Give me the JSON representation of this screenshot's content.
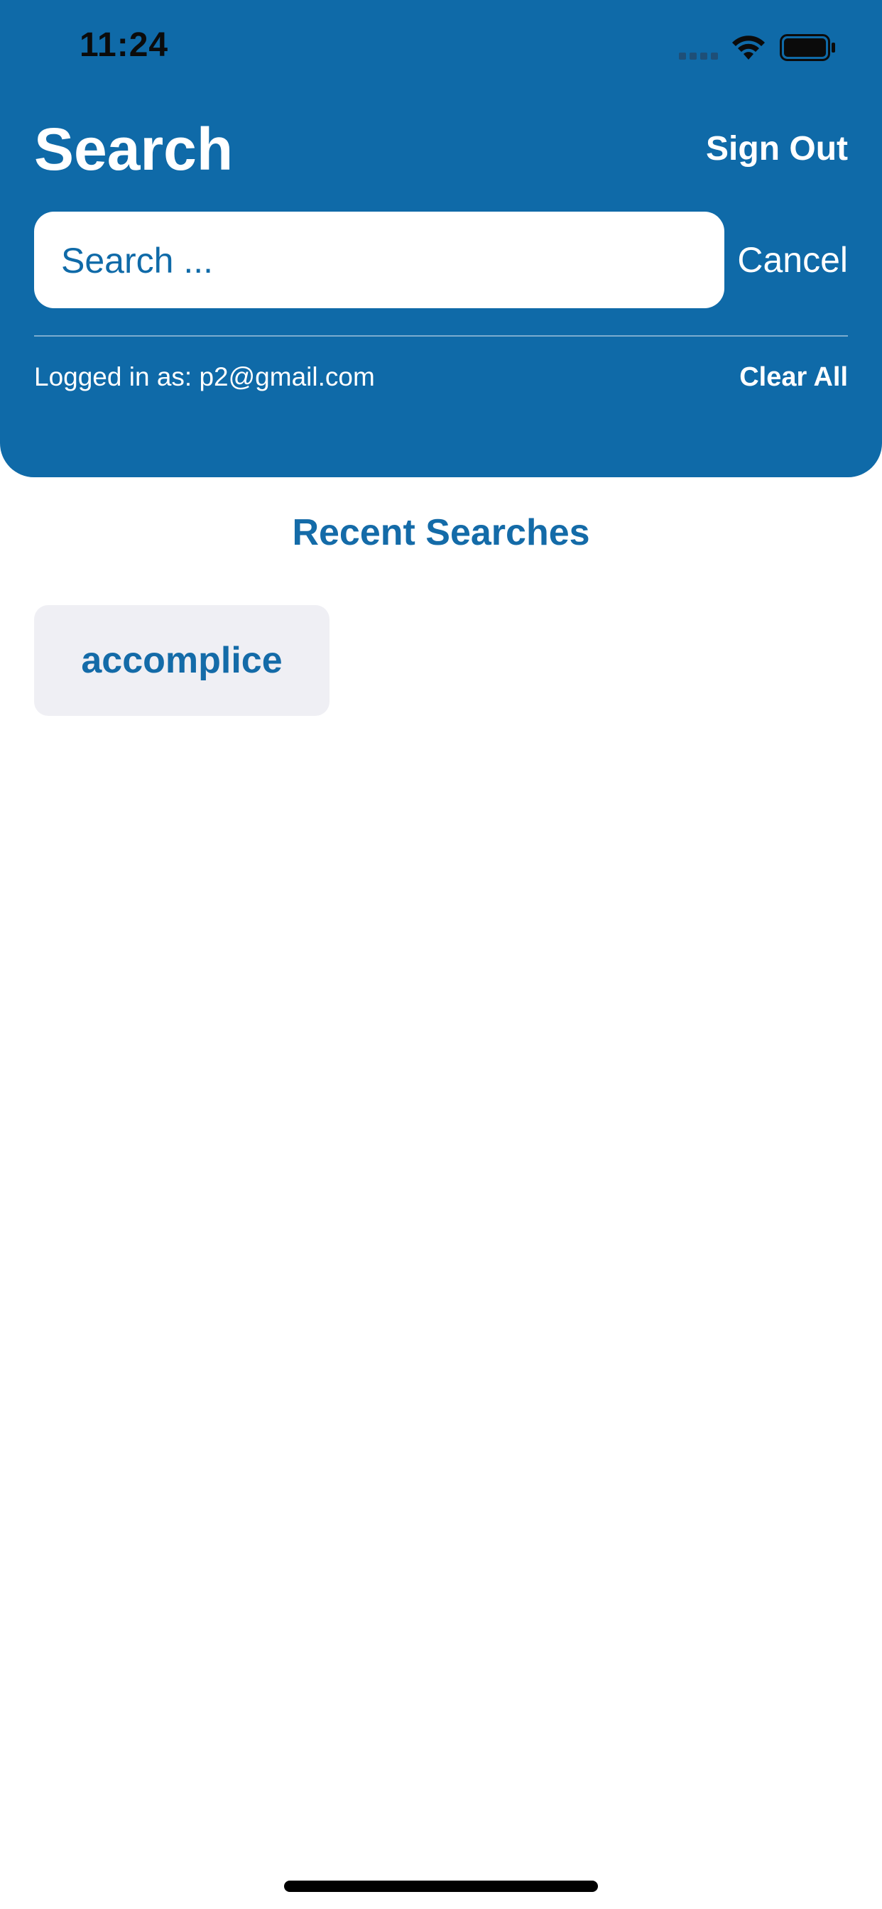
{
  "status_bar": {
    "time": "11:24"
  },
  "header": {
    "title": "Search",
    "sign_out_label": "Sign Out",
    "search": {
      "value": "",
      "placeholder": "Search ..."
    },
    "cancel_label": "Cancel",
    "logged_in_text": "Logged in as: p2@gmail.com",
    "clear_all_label": "Clear All"
  },
  "recent": {
    "title": "Recent Searches",
    "items": [
      {
        "label": "accomplice"
      }
    ]
  },
  "colors": {
    "header_bg": "#0f6aa8",
    "accent": "#146ba8",
    "chip_bg": "#efeff4"
  },
  "icons": {
    "signal": "cellular-signal-icon",
    "wifi": "wifi-icon",
    "battery": "battery-icon"
  }
}
